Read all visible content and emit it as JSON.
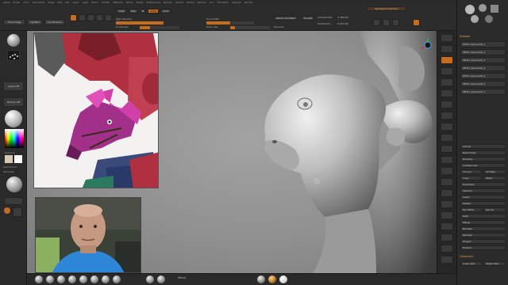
{
  "app": {
    "title": "ZBrush",
    "title_short": "ZBrush"
  },
  "menu": {
    "items": [
      "Alpha",
      "Brush",
      "Color",
      "Document",
      "Draw",
      "Edit",
      "File",
      "Layer",
      "Light",
      "Macro",
      "Marker",
      "Material",
      "Movie",
      "Picker",
      "Preferences",
      "Render",
      "Stencil",
      "Stroke",
      "Texture",
      "Tool",
      "Transform",
      "Zplugin",
      "Zscript"
    ]
  },
  "shelf": {
    "home_page": "Home Page",
    "lightbox": "LightBox",
    "live_boolean": "Live Boolean",
    "edit": "Edit",
    "draw": "Draw",
    "move": "Move",
    "scale": "Scale",
    "rotate": "Rotate",
    "mrgb": "Mrgb",
    "rgb": "Rgb",
    "m": "M",
    "zadd": "Zadd",
    "zsub": "Zsub",
    "rgb_intensity_label": "Rgb Intensity",
    "rgb_intensity_value": 100,
    "z_intensity_label": "Z Intensity",
    "z_intensity_value": 25,
    "focal_shift_label": "Focal Shift",
    "focal_shift_value": 0,
    "draw_size_label": "Draw Size",
    "draw_size_value": 64,
    "dynamic_label": "Dynamic",
    "mirror_weld_label": "Mirror And Weld",
    "double_label": "Double",
    "active_points_label": "ActivePoints:",
    "active_points_value": "4.366 Mil",
    "total_points_label": "TotalPoints:",
    "total_points_value": "8.683 Mil",
    "spotlight_label": "Spotlight Projection"
  },
  "left_tray": {
    "alpha_off": "Alpha Off",
    "texture_off": "Texture Off",
    "gradient": "Gradient",
    "switch_color": "SwitchColor",
    "alternate": "Alternate"
  },
  "right_panel": {
    "subtool_header": "Subtool",
    "geometry_header": "Geometry",
    "list_all": "List All",
    "new_folder": "New Folder",
    "rename": "Rename",
    "auto_reorder": "AutoReorder",
    "all_low": "All Low",
    "all_high": "All High",
    "copy": "Copy",
    "paste": "Paste",
    "duplicate": "Duplicate",
    "append": "Append",
    "insert": "Insert",
    "delete": "Delete",
    "del_other": "Del Other",
    "del_all": "Del All",
    "split": "Split",
    "merge": "Merge",
    "boolean": "Boolean",
    "remesh": "Remesh",
    "project": "Project",
    "extract": "Extract",
    "lower_res": "Lower Res",
    "higher_res": "Higher Res",
    "subtools": [
      "PM3D_Sphere3D_1",
      "PM3D_Sphere3D_2",
      "PM3D_Sphere3D_3",
      "PM3D_Sphere3D_4",
      "PM3D_Sphere3D_5",
      "PM3D_Sphere3D_6",
      "PM3D_Sphere3D_7"
    ]
  },
  "bottom_shelf": {
    "items": [
      "Standard",
      "Move",
      "ClayBuildup",
      "DamStandard",
      "hPolish",
      "TrimDynamic",
      "Inflat",
      "Pinch"
    ],
    "mirror": "Mirror"
  },
  "colors": {
    "accent": "#c76b1d",
    "bg": "#1e1e1e",
    "panel": "#2b2b2b",
    "canvas": "#909090",
    "swatch_main": "#d8c9b4",
    "swatch_secondary": "#ffffff"
  }
}
